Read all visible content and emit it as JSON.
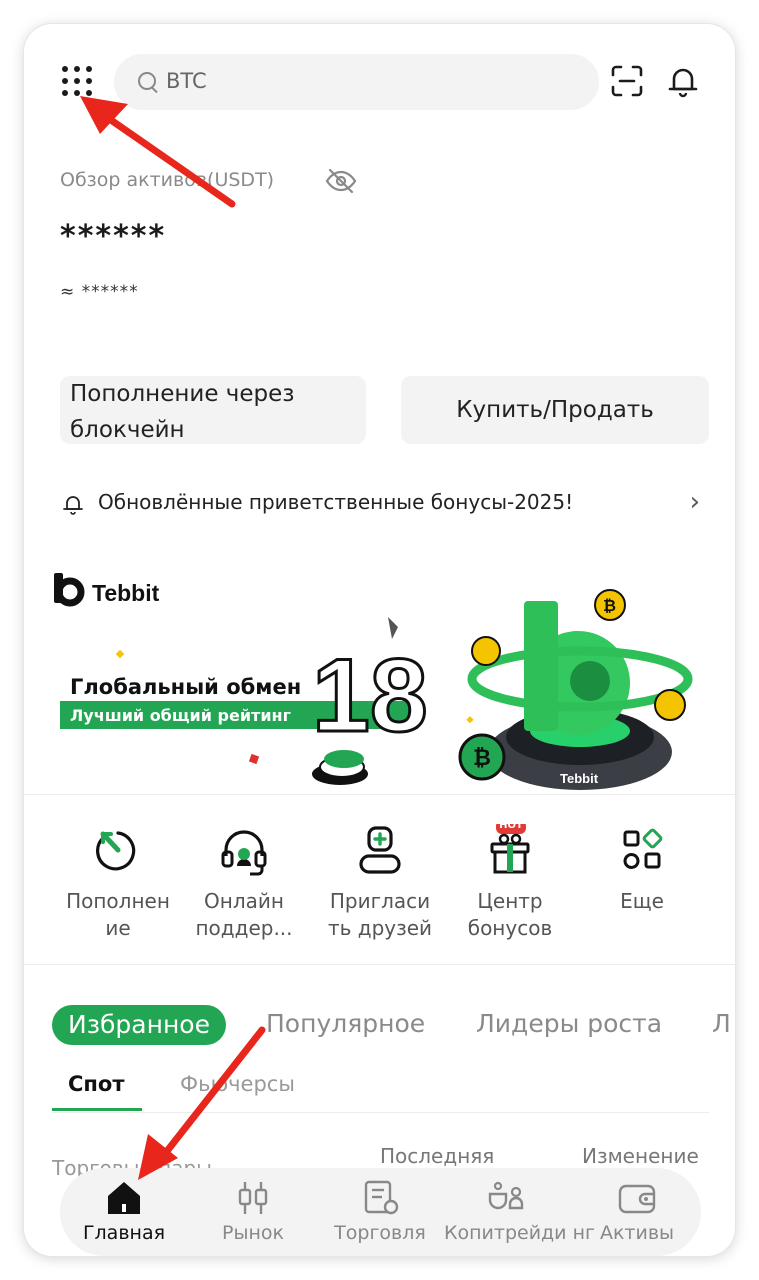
{
  "search": {
    "placeholder": "BTC"
  },
  "overview": {
    "label": "Обзор активов(USDT)",
    "balance": "******",
    "approx": "≈ ******"
  },
  "actions": {
    "deposit": "Пополнение через блокчейн",
    "buy_sell": "Купить/Продать"
  },
  "notice": {
    "text": "Обновлённые приветственные бонусы-2025!"
  },
  "banner": {
    "brand": "Tebbit",
    "headline": "Глобальный обмен",
    "tagline": "Лучший общий рейтинг",
    "number": "18",
    "platform_brand": "Tebbit"
  },
  "quick_menu": [
    {
      "label": "Пополнен ие",
      "icon": "deposit-icon"
    },
    {
      "label": "Онлайн поддер...",
      "icon": "headset-icon"
    },
    {
      "label": "Пригласи ть друзей",
      "icon": "invite-icon"
    },
    {
      "label": "Центр бонусов",
      "icon": "gift-icon",
      "badge": "HOT"
    },
    {
      "label": "Еще",
      "icon": "more-icon"
    }
  ],
  "market_tabs": [
    {
      "label": "Избранное",
      "active": true
    },
    {
      "label": "Популярное",
      "active": false
    },
    {
      "label": "Лидеры роста",
      "active": false
    },
    {
      "label": "Л",
      "active": false
    }
  ],
  "sub_tabs": [
    {
      "label": "Спот",
      "active": true
    },
    {
      "label": "Фьючерсы",
      "active": false
    }
  ],
  "columns": [
    "Торговые пары",
    "Последняя",
    "Изменение"
  ],
  "bottom_nav": [
    {
      "label": "Главная",
      "icon": "home-icon",
      "active": true
    },
    {
      "label": "Рынок",
      "icon": "candles-icon",
      "active": false
    },
    {
      "label": "Торговля",
      "icon": "trade-icon",
      "active": false
    },
    {
      "label": "Копитрейди нг",
      "icon": "copytrade-icon",
      "active": false
    },
    {
      "label": "Активы",
      "icon": "wallet-icon",
      "active": false
    }
  ],
  "colors": {
    "accent": "#22a653",
    "text": "#1b1b1b",
    "muted": "#8a8a8a",
    "annotation": "#e8261b"
  }
}
